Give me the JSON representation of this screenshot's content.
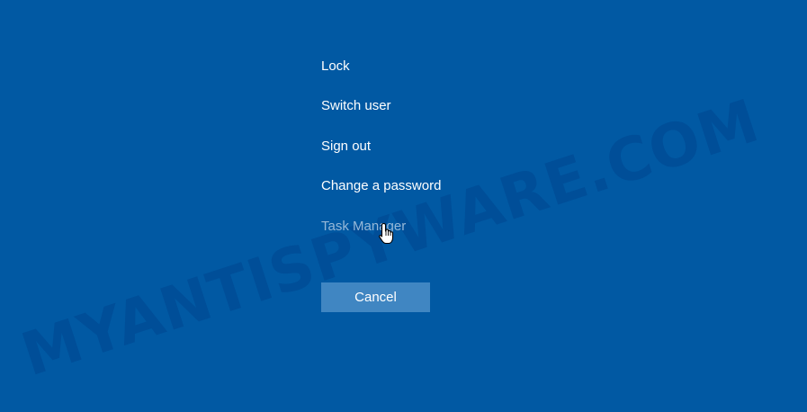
{
  "menu": {
    "items": [
      {
        "label": "Lock"
      },
      {
        "label": "Switch user"
      },
      {
        "label": "Sign out"
      },
      {
        "label": "Change a password"
      },
      {
        "label": "Task Manager",
        "state": "hover"
      }
    ]
  },
  "cancel_button": {
    "label": "Cancel"
  },
  "watermark": {
    "text": "MYANTISPYWARE.COM"
  },
  "cursor": {
    "icon": "hand-pointer-icon"
  },
  "colors": {
    "background": "#0159a3",
    "menu_text": "#ffffff",
    "menu_text_hover": "#96b8d8",
    "button_background": "#4086c2"
  }
}
